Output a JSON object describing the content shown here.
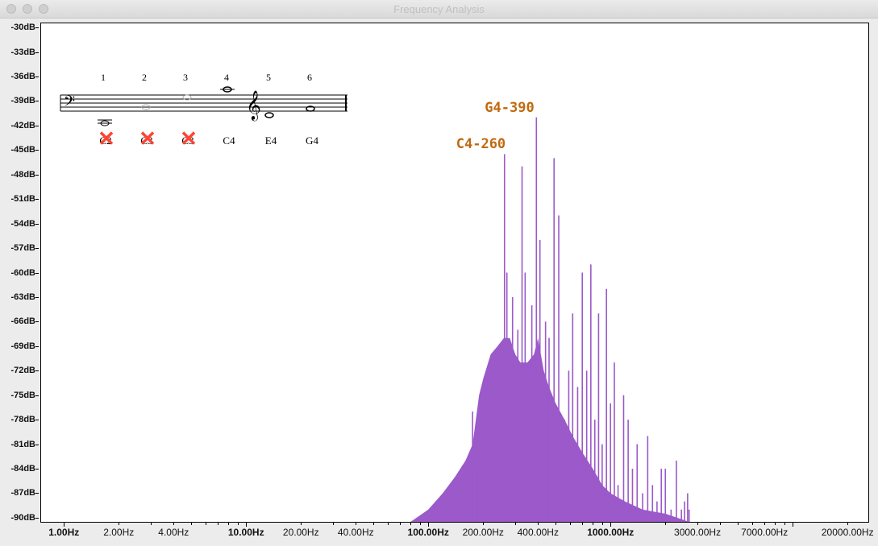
{
  "window": {
    "title": "Frequency Analysis"
  },
  "chart_data": {
    "type": "area",
    "xscale": "log",
    "xlim": [
      0.75,
      26000
    ],
    "ylim": [
      -90.5,
      -29.5
    ],
    "x_ticks": [
      {
        "value": 1,
        "label": "1.00Hz",
        "bold": true
      },
      {
        "value": 2,
        "label": "2.00Hz",
        "bold": false
      },
      {
        "value": 4,
        "label": "4.00Hz",
        "bold": false
      },
      {
        "value": 10,
        "label": "10.00Hz",
        "bold": true
      },
      {
        "value": 20,
        "label": "20.00Hz",
        "bold": false
      },
      {
        "value": 40,
        "label": "40.00Hz",
        "bold": false
      },
      {
        "value": 100,
        "label": "100.00Hz",
        "bold": true
      },
      {
        "value": 200,
        "label": "200.00Hz",
        "bold": false
      },
      {
        "value": 400,
        "label": "400.00Hz",
        "bold": false
      },
      {
        "value": 1000,
        "label": "1000.00Hz",
        "bold": true
      },
      {
        "value": 3000,
        "label": "3000.00Hz",
        "bold": false
      },
      {
        "value": 7000,
        "label": "7000.00Hz",
        "bold": false
      },
      {
        "value": 20000,
        "label": "20000.00Hz",
        "bold": false
      }
    ],
    "y_ticks": [
      {
        "value": -30,
        "label": "-30dB"
      },
      {
        "value": -33,
        "label": "-33dB"
      },
      {
        "value": -36,
        "label": "-36dB"
      },
      {
        "value": -39,
        "label": "-39dB"
      },
      {
        "value": -42,
        "label": "-42dB"
      },
      {
        "value": -45,
        "label": "-45dB"
      },
      {
        "value": -48,
        "label": "-48dB"
      },
      {
        "value": -51,
        "label": "-51dB"
      },
      {
        "value": -54,
        "label": "-54dB"
      },
      {
        "value": -57,
        "label": "-57dB"
      },
      {
        "value": -60,
        "label": "-60dB"
      },
      {
        "value": -63,
        "label": "-63dB"
      },
      {
        "value": -66,
        "label": "-66dB"
      },
      {
        "value": -69,
        "label": "-69dB"
      },
      {
        "value": -72,
        "label": "-72dB"
      },
      {
        "value": -75,
        "label": "-75dB"
      },
      {
        "value": -78,
        "label": "-78dB"
      },
      {
        "value": -81,
        "label": "-81dB"
      },
      {
        "value": -84,
        "label": "-84dB"
      },
      {
        "value": -87,
        "label": "-87dB"
      },
      {
        "value": -90,
        "label": "-90dB"
      }
    ],
    "color": "#9b59c9",
    "envelope": [
      [
        80,
        -90.5
      ],
      [
        100,
        -89
      ],
      [
        120,
        -87
      ],
      [
        140,
        -85
      ],
      [
        160,
        -83
      ],
      [
        175,
        -81
      ],
      [
        180,
        -79
      ],
      [
        190,
        -75
      ],
      [
        200,
        -73
      ],
      [
        220,
        -70
      ],
      [
        240,
        -69
      ],
      [
        260,
        -68
      ],
      [
        280,
        -68
      ],
      [
        300,
        -70
      ],
      [
        320,
        -71
      ],
      [
        350,
        -71
      ],
      [
        380,
        -70
      ],
      [
        400,
        -68
      ],
      [
        430,
        -72
      ],
      [
        460,
        -74
      ],
      [
        500,
        -76
      ],
      [
        560,
        -78
      ],
      [
        620,
        -80
      ],
      [
        700,
        -82
      ],
      [
        800,
        -84
      ],
      [
        900,
        -86
      ],
      [
        1000,
        -87
      ],
      [
        1200,
        -88
      ],
      [
        1500,
        -89
      ],
      [
        2000,
        -89.5
      ],
      [
        2700,
        -90.5
      ]
    ],
    "peaks": [
      [
        175,
        -77
      ],
      [
        185,
        -84
      ],
      [
        262,
        -45.5
      ],
      [
        270,
        -60
      ],
      [
        290,
        -63
      ],
      [
        310,
        -67
      ],
      [
        327,
        -47
      ],
      [
        340,
        -60
      ],
      [
        370,
        -64
      ],
      [
        392,
        -41
      ],
      [
        410,
        -56
      ],
      [
        440,
        -66
      ],
      [
        460,
        -68
      ],
      [
        490,
        -46
      ],
      [
        520,
        -53
      ],
      [
        560,
        -78
      ],
      [
        590,
        -72
      ],
      [
        620,
        -65
      ],
      [
        660,
        -74
      ],
      [
        700,
        -60
      ],
      [
        740,
        -72
      ],
      [
        780,
        -59
      ],
      [
        820,
        -78
      ],
      [
        860,
        -65
      ],
      [
        900,
        -81
      ],
      [
        950,
        -62
      ],
      [
        1000,
        -76
      ],
      [
        1050,
        -71
      ],
      [
        1100,
        -86
      ],
      [
        1180,
        -75
      ],
      [
        1250,
        -78
      ],
      [
        1320,
        -84
      ],
      [
        1400,
        -81
      ],
      [
        1500,
        -87
      ],
      [
        1600,
        -80
      ],
      [
        1700,
        -86
      ],
      [
        1800,
        -88
      ],
      [
        1900,
        -84
      ],
      [
        2000,
        -84
      ],
      [
        2150,
        -89
      ],
      [
        2300,
        -83
      ],
      [
        2450,
        -89
      ],
      [
        2550,
        -88
      ],
      [
        2650,
        -87
      ],
      [
        2700,
        -89
      ]
    ],
    "annotations": [
      {
        "text": "C4-260",
        "x": 262,
        "y": -45.5
      },
      {
        "text": "G4-390",
        "x": 392,
        "y": -41
      }
    ]
  },
  "music_inset": {
    "numbers": [
      "1",
      "2",
      "3",
      "4",
      "5",
      "6"
    ],
    "notes": [
      "C2",
      "C3",
      "C3",
      "C4",
      "E4",
      "G4"
    ],
    "crossed": [
      true,
      true,
      true,
      false,
      false,
      false
    ]
  }
}
